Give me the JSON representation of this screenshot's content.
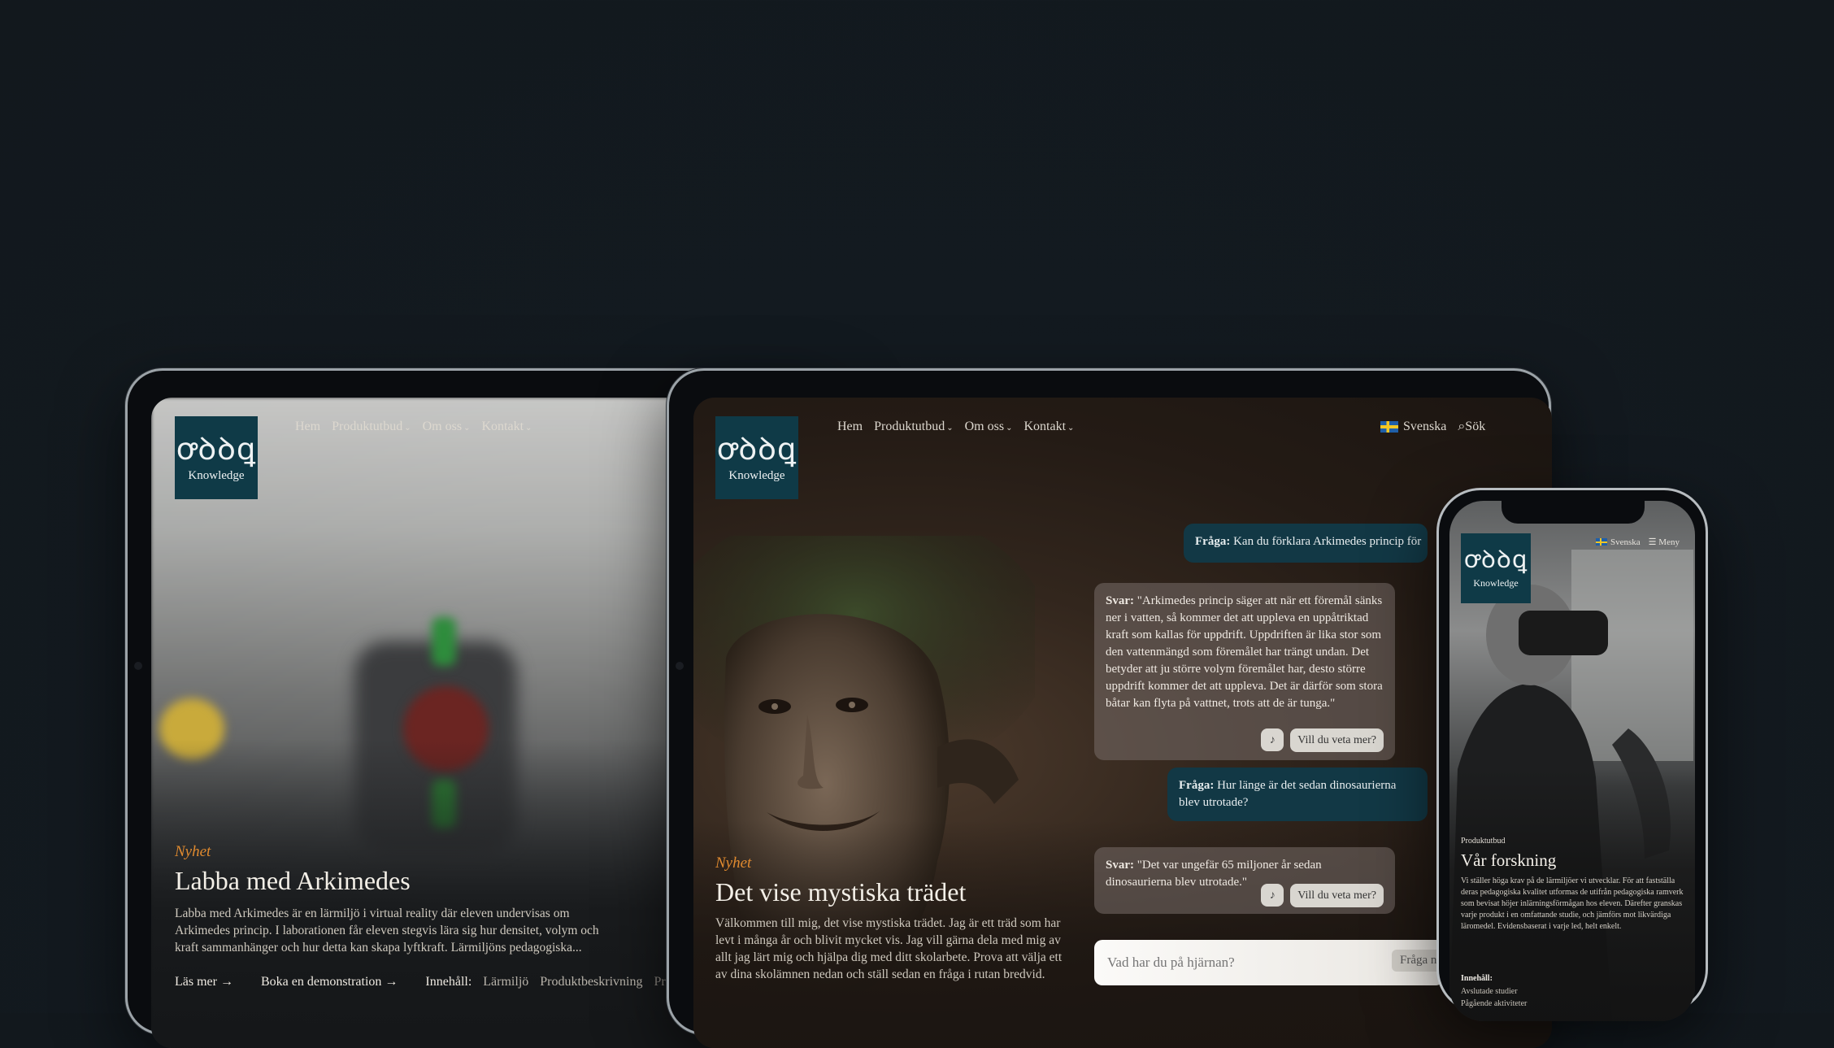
{
  "brand": {
    "glyph": "ꝍꝺꝺꝗ",
    "name": "Knowledge"
  },
  "nav": {
    "home": "Hem",
    "products": "Produktutbud",
    "about": "Om oss",
    "contact": "Kontakt",
    "language": "Svenska",
    "search": "Sök",
    "menu": "Meny"
  },
  "left_tablet": {
    "tag": "Nyhet",
    "title": "Labba med Arkimedes",
    "body": "Labba med Arkimedes är en lärmiljö i virtual reality där eleven undervisas om Arkimedes princip. I laborationen får eleven stegvis lära sig hur densitet, volym och kraft sammanhänger och hur detta kan skapa lyftkraft. Lärmiljöns pedagogiska...",
    "read_more": "Läs mer",
    "book_demo": "Boka en demonstration",
    "contents_label": "Innehåll:",
    "contents": [
      "Lärmiljö",
      "Produktbeskrivning",
      "Pr"
    ]
  },
  "center_tablet": {
    "tag": "Nyhet",
    "title": "Det vise mystiska trädet",
    "body": "Välkommen till mig, det vise mystiska trädet. Jag är ett träd som har levt i många år och blivit mycket vis. Jag vill gärna dela med mig av allt jag lärt mig och hjälpa dig med ditt skolarbete. Prova att välja ett av dina skolämnen nedan och ställ sedan en fråga i rutan bredvid.",
    "chat": [
      {
        "role": "q",
        "label": "Fråga:",
        "text": "Kan du förklara Arkimedes princip för"
      },
      {
        "role": "a",
        "label": "Svar:",
        "text": "\"Arkimedes princip säger att när ett föremål sänks ner i vatten, så kommer det att uppleva en uppåtriktad kraft som kallas för uppdrift. Uppdriften är lika stor som den vattenmängd som föremålet har trängt undan. Det betyder att ju större volym föremålet har, desto större uppdrift kommer det att uppleva. Det är därför som stora båtar kan flyta på vattnet, trots att de är tunga.\""
      },
      {
        "role": "q",
        "label": "Fråga:",
        "text": "Hur länge är det sedan dinosaurierna blev utrotade?"
      },
      {
        "role": "a",
        "label": "Svar:",
        "text": "\"Det var ungefär 65 miljoner år sedan dinosaurierna blev utrotade.\""
      }
    ],
    "more": "Vill du veta mer?",
    "input_placeholder": "Vad har du på hjärnan?",
    "ask_button": "Fråga n"
  },
  "phone": {
    "kicker": "Produktutbud",
    "title": "Vår forskning",
    "body": "Vi ställer höga krav på de lärmiljöer vi utvecklar. För att fastställa deras pedagogiska kvalitet utformas de utifrån pedagogiska ramverk som bevisat höjer inlärningsförmågan hos eleven. Därefter granskas varje produkt i en omfattande studie, och jämförs mot likvärdiga läromedel. Evidensbaserat i varje led, helt enkelt.",
    "contents_label": "Innehåll:",
    "contents": [
      "Avslutade studier",
      "Pågående aktiviteter"
    ]
  },
  "colors": {
    "background": "#12181d",
    "brand_teal": "#0f3a47",
    "accent_orange": "#e08a2f"
  }
}
